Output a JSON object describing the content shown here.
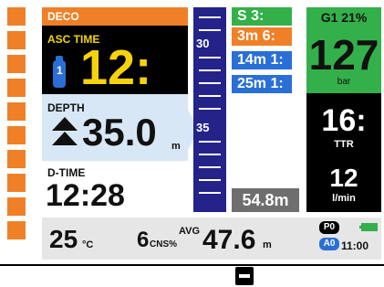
{
  "deco_header": {
    "label": "DECO"
  },
  "ascent": {
    "label": "ASC TIME",
    "value": "12:",
    "tank_number": "1"
  },
  "depth": {
    "label": "DEPTH",
    "value": "35.0",
    "unit": "m"
  },
  "dive_time": {
    "label": "D-TIME",
    "value": "12:28"
  },
  "depth_scale": {
    "labels": [
      "30",
      "35"
    ]
  },
  "stops": [
    {
      "text": "S 3:",
      "color": "#34b04a"
    },
    {
      "text": "3m 6:",
      "color": "#f08028"
    },
    {
      "text": "14m 1:",
      "color": "#2a6fd6"
    },
    {
      "text": "25m 1:",
      "color": "#2a6fd6"
    }
  ],
  "max_depth": {
    "value": "54.8m"
  },
  "gas": {
    "label": "G1 21%"
  },
  "pressure": {
    "value": "127",
    "unit": "bar"
  },
  "ttr": {
    "value": "16:",
    "label": "TTR"
  },
  "sac": {
    "value": "12",
    "unit": "l/min"
  },
  "status": {
    "temperature": "25",
    "temperature_unit": "°C",
    "cns": "6",
    "cns_unit": "CNS%",
    "avg_label": "AVG",
    "avg_depth": "47.6",
    "avg_unit": "m",
    "p_badge": "P0",
    "a_badge": "A0",
    "time": "11:00"
  },
  "colors": {
    "orange": "#f08028",
    "green": "#34b04a",
    "blue": "#2a6fd6",
    "navy": "#23238a",
    "yellow": "#f6d20c"
  }
}
